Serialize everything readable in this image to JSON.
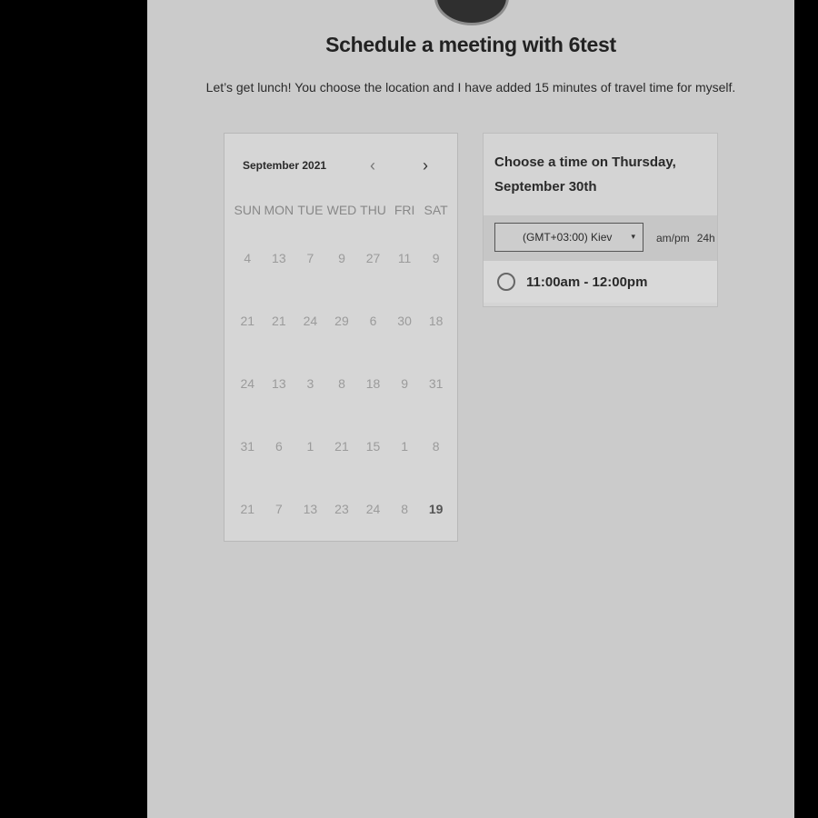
{
  "page": {
    "title": "Schedule a meeting with 6test",
    "description": "Let’s get lunch! You choose the location and I have added 15 minutes of travel time for myself."
  },
  "calendar": {
    "month_label": "September 2021",
    "prev_icon": "‹",
    "next_icon": "›",
    "weekdays": [
      "SUN",
      "MON",
      "TUE",
      "WED",
      "THU",
      "FRI",
      "SAT"
    ],
    "weeks": [
      [
        "4",
        "13",
        "7",
        "9",
        "27",
        "11",
        "9"
      ],
      [
        "21",
        "21",
        "24",
        "29",
        "6",
        "30",
        "18"
      ],
      [
        "24",
        "13",
        "3",
        "8",
        "18",
        "9",
        "31"
      ],
      [
        "31",
        "6",
        "1",
        "21",
        "15",
        "1",
        "8"
      ],
      [
        "21",
        "7",
        "13",
        "23",
        "24",
        "8",
        "19"
      ]
    ],
    "available_day": "19"
  },
  "times": {
    "header": "Choose a time on Thursday, September 30th",
    "timezone": "(GMT+03:00) Kiev",
    "timezone_caret": "▾",
    "format_ampm": "am/pm",
    "format_24h": "24h",
    "slots": [
      {
        "label": "11:00am - 12:00pm"
      }
    ]
  }
}
